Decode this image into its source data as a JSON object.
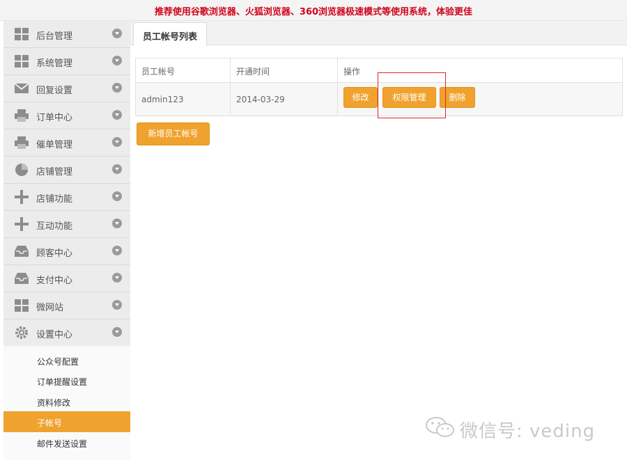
{
  "notice": {
    "text": "推荐使用谷歌浏览器、火狐浏览器、360浏览器极速模式等使用系统，体验更佳"
  },
  "sidebar": {
    "items": [
      {
        "label": "后台管理",
        "icon": "grid-icon"
      },
      {
        "label": "系统管理",
        "icon": "grid-icon"
      },
      {
        "label": "回复设置",
        "icon": "envelope-icon"
      },
      {
        "label": "订单中心",
        "icon": "printer-icon"
      },
      {
        "label": "催单管理",
        "icon": "printer-icon"
      },
      {
        "label": "店铺管理",
        "icon": "pie-chart-icon"
      },
      {
        "label": "店铺功能",
        "icon": "plus-icon"
      },
      {
        "label": "互动功能",
        "icon": "plus-icon"
      },
      {
        "label": "顾客中心",
        "icon": "inbox-icon"
      },
      {
        "label": "支付中心",
        "icon": "inbox-icon"
      },
      {
        "label": "微网站",
        "icon": "grid-icon"
      },
      {
        "label": "设置中心",
        "icon": "gear-icon"
      }
    ],
    "submenu": [
      {
        "label": "公众号配置",
        "active": false
      },
      {
        "label": "订单提醒设置",
        "active": false
      },
      {
        "label": "资料修改",
        "active": false
      },
      {
        "label": "子帐号",
        "active": true
      },
      {
        "label": "邮件发送设置",
        "active": false
      }
    ]
  },
  "tabs": [
    {
      "label": "员工帐号列表"
    }
  ],
  "table": {
    "headers": [
      "员工帐号",
      "开通时间",
      "操作"
    ],
    "rows": [
      {
        "account": "admin123",
        "date": "2014-03-29",
        "actions": [
          "修改",
          "权限管理",
          "删除"
        ]
      }
    ]
  },
  "add_button": {
    "label": "新增员工帐号"
  },
  "watermark": {
    "text": "微信号: veding"
  },
  "colors": {
    "accent": "#f0a22e",
    "notice": "#d0021b",
    "highlight": "#d9262b"
  }
}
